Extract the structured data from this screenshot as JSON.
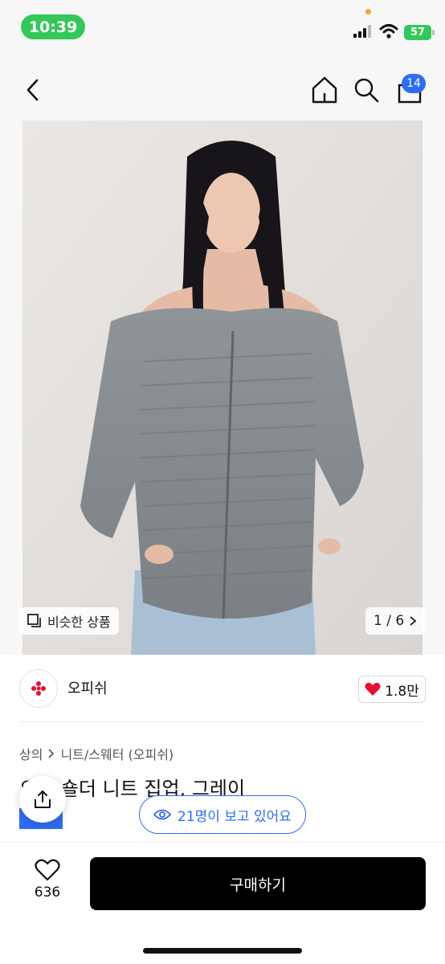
{
  "status": {
    "time": "10:39",
    "battery": "57"
  },
  "nav": {
    "cart_count": "14"
  },
  "image": {
    "similar_label": "비슷한 상품",
    "page_indicator": "1 / 6"
  },
  "store": {
    "name": "오피쉬",
    "like_count": "1.8만"
  },
  "breadcrumb": {
    "category": "상의",
    "subcategory": "니트/스웨터 (오피쉬)"
  },
  "product": {
    "title": "오프 숄더 니트 집업, 그레이"
  },
  "viewers": {
    "text": "21명이 보고 있어요"
  },
  "bottom": {
    "wish_count": "636",
    "buy_label": "구매하기"
  },
  "colors": {
    "accent_blue": "#2d6df6",
    "status_green": "#34c759",
    "like_red": "#e8112d"
  }
}
